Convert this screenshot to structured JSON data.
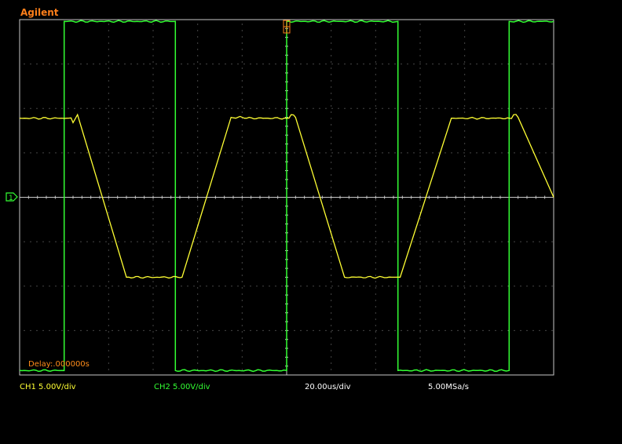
{
  "brand": "Agilent",
  "delay_text": "Delay:.000000s",
  "status": {
    "ch1": "CH1 5.00V/div",
    "ch2": "CH2 5.00V/div",
    "timebase": "20.00us/div",
    "sample_rate": "5.00MSa/s"
  },
  "colors": {
    "ch1": "#ffff33",
    "ch2": "#33ff33",
    "grid": "#8a8a8a",
    "frame": "#c8c8c8",
    "text_accent": "#ff8c1a",
    "marker": "#ff7f1a"
  },
  "chart_data": {
    "type": "line",
    "xlim": [
      -120,
      120
    ],
    "ylim": [
      -20,
      20
    ],
    "x_unit": "us",
    "y_unit": "V",
    "grid": true,
    "series": [
      {
        "name": "CH1",
        "x": [
          -120,
          -99,
          -96,
          -94,
          -72,
          -49,
          -47,
          -25,
          -22,
          -19,
          0,
          2,
          4,
          26,
          49,
          51,
          74,
          77,
          100,
          102,
          104,
          120
        ],
        "y": [
          8.9,
          8.9,
          8.4,
          9.3,
          -9.0,
          -9.0,
          -9.0,
          9.0,
          9.0,
          8.9,
          8.9,
          9.3,
          9.0,
          -9.0,
          -9.0,
          -9.0,
          8.9,
          8.9,
          8.9,
          9.3,
          9.0,
          0.0
        ]
      },
      {
        "name": "CH2",
        "x": [
          -120,
          -100,
          -100,
          -50,
          -50,
          0,
          0,
          50,
          50,
          100,
          100,
          120
        ],
        "y": [
          -19.5,
          -19.5,
          19.8,
          19.8,
          -19.5,
          -19.5,
          19.8,
          19.8,
          -19.5,
          -19.5,
          19.8,
          19.8
        ]
      }
    ]
  }
}
